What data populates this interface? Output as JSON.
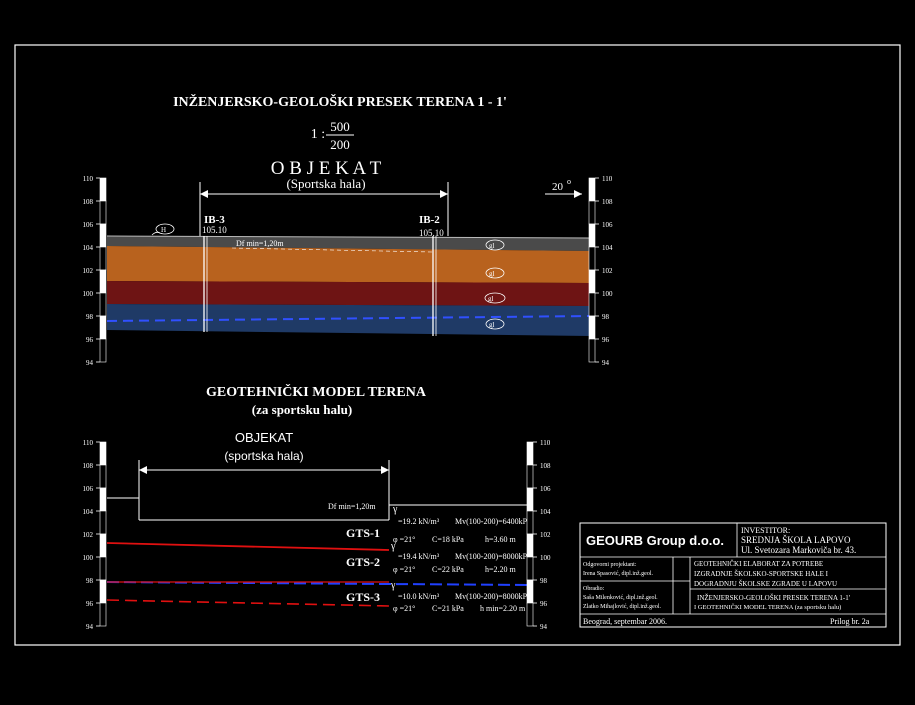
{
  "section": {
    "title": "INŽENJERSKO-GEOLOŠKI PRESEK  TERENA  1 - 1'",
    "scale_prefix": "1 :",
    "scale_num": "500",
    "scale_den": "200",
    "object_label": "O B J E K A T",
    "object_sub": "(Sportska hala)",
    "angle_label": "20",
    "boreholes": [
      {
        "name": "IB-3",
        "elev": "105.10"
      },
      {
        "name": "IB-2",
        "elev": "105.10"
      }
    ],
    "df_label": "Df min=1,20m",
    "layer_codes": [
      "gl",
      "gl",
      "gl",
      "gl"
    ],
    "left_code": "H",
    "axis_ticks": [
      "110",
      "108",
      "106",
      "104",
      "102",
      "100",
      "98",
      "96",
      "94"
    ]
  },
  "model": {
    "title": "GEOTEHNIČKI MODEL TERENA",
    "subtitle": "(za sportsku halu)",
    "object_label": "OBJEKAT",
    "object_sub": "(sportska hala)",
    "df_label": "Df min=1,20m",
    "layers": [
      {
        "name": "GTS-1",
        "gamma": "=19.2 kN/m³",
        "mv": "Mv(100-200)=6400kPa",
        "phi": "φ =21°",
        "c": "C=18 kPa",
        "h": "h=3.60 m"
      },
      {
        "name": "GTS-2",
        "gamma": "=19.4 kN/m³",
        "mv": "Mv(100-200)=8000kPa",
        "phi": "φ =21°",
        "c": "C=22 kPa",
        "h": "h=2.20 m"
      },
      {
        "name": "GTS-3",
        "gamma": "=10.0 kN/m³",
        "mv": "Mv(100-200)=8000kPa",
        "phi": "φ =21°",
        "c": "C=21 kPa",
        "h": "h min=2.20 m"
      }
    ],
    "axis_ticks": [
      "110",
      "108",
      "106",
      "104",
      "102",
      "100",
      "98",
      "96",
      "94"
    ]
  },
  "title_block": {
    "company": "GEOURB Group d.o.o.",
    "investor_label": "INVESTITOR:",
    "investor_name": "SREDNJA ŠKOLA LAPOVO",
    "investor_addr": "Ul. Svetozara Markoviča br. 43.",
    "resp_label": "Odgovorni projektant:",
    "resp_name": "Irena Spasović, dipl.inž.geol.",
    "project_line1": "GEOTEHNIČKI ELABORAT ZA POTREBE",
    "project_line2": "IZGRADNJE ŠKOLSKO-SPORTSKE HALE I",
    "project_line3": "DOGRADNJU ŠKOLSKE ZGRADE U LAPOVU",
    "made_label": "Obradio:",
    "made_name1": "Saša Milenković, dipl.inž.geol.",
    "made_name2": "Zlatko Mihajlović, dipl.inž.geol.",
    "drawing_line1": "INŽENJERSKO-GEOLOŠKI PRESEK TERENA 1-1'",
    "drawing_line2": "I GEOTEHNIČKI MODEL TERENA   (za sportsku halu)",
    "place_date": "Beograd, septembar 2006.",
    "attachment": "Prilog br. 2a"
  },
  "colors": {
    "brown": "#b8621e",
    "darkred": "#6e1414",
    "blue": "#1f3a66",
    "grey": "#4a4a4a",
    "red_line": "#e01010",
    "blue_line": "#2040ff"
  }
}
